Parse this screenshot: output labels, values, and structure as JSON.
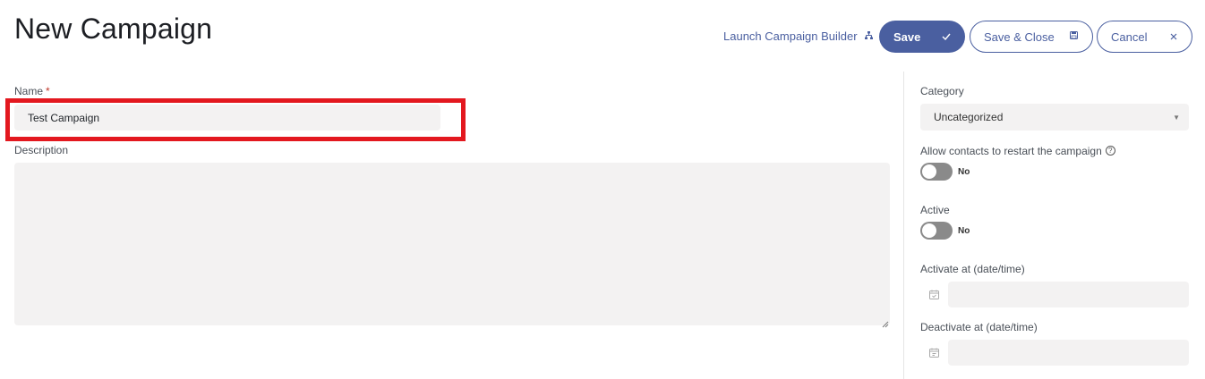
{
  "header": {
    "title": "New Campaign",
    "launch_label": "Launch Campaign Builder",
    "save_label": "Save",
    "save_close_label": "Save & Close",
    "cancel_label": "Cancel"
  },
  "form": {
    "name_label": "Name",
    "name_required_mark": "*",
    "name_value": "Test Campaign",
    "description_label": "Description",
    "description_value": ""
  },
  "sidebar": {
    "category_label": "Category",
    "category_value": "Uncategorized",
    "restart_label": "Allow contacts to restart the campaign",
    "restart_value": "No",
    "active_label": "Active",
    "active_value": "No",
    "activate_label": "Activate at (date/time)",
    "activate_value": "",
    "deactivate_label": "Deactivate at (date/time)",
    "deactivate_value": ""
  },
  "colors": {
    "primary": "#4a5fa0",
    "highlight": "#e3181f",
    "field_bg": "#f3f2f2",
    "toggle_off": "#8a8a8a"
  },
  "icons": {
    "launch": "sitemap-icon",
    "save": "check-icon",
    "save_close": "floppy-disk-icon",
    "cancel": "close-icon",
    "help": "question-circle-icon",
    "calendar": "calendar-icon",
    "select_caret": "caret-down-icon"
  }
}
